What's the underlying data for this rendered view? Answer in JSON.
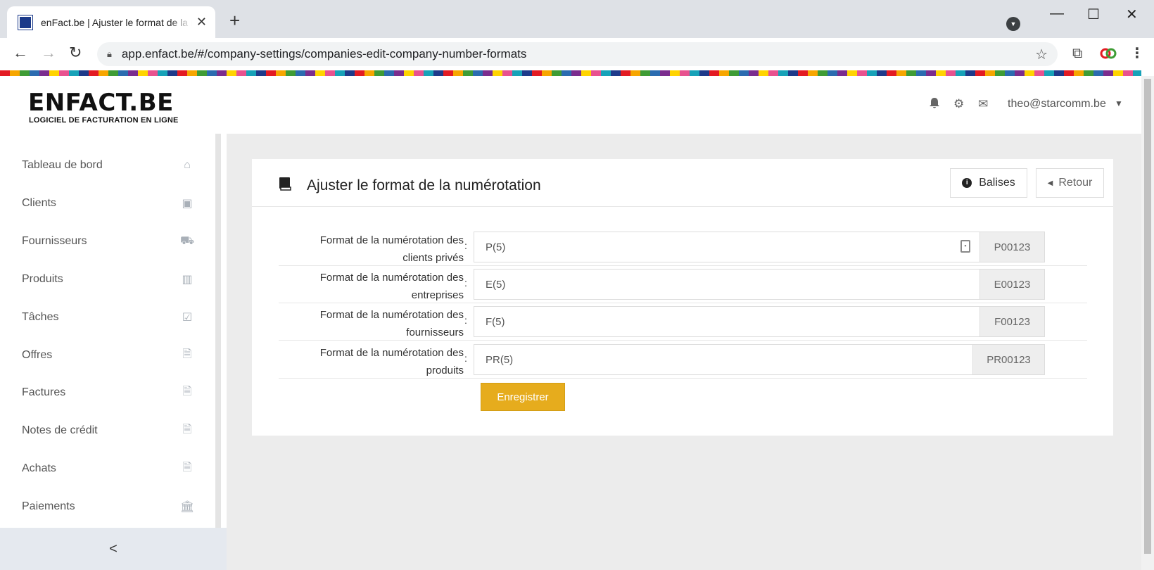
{
  "browser": {
    "tab_title": "enFact.be | Ajuster le format de la numérotation",
    "url": "app.enfact.be/#/company-settings/companies-edit-company-number-formats"
  },
  "header": {
    "logo_title": "ENFACT.BE",
    "logo_subtitle": "LOGICIEL DE FACTURATION EN LIGNE",
    "user_email": "theo@starcomm.be"
  },
  "sidebar": {
    "items": [
      {
        "label": "Tableau de bord",
        "icon": "home-icon"
      },
      {
        "label": "Clients",
        "icon": "contact-card-icon"
      },
      {
        "label": "Fournisseurs",
        "icon": "truck-icon"
      },
      {
        "label": "Produits",
        "icon": "barcode-icon"
      },
      {
        "label": "Tâches",
        "icon": "clipboard-check-icon"
      },
      {
        "label": "Offres",
        "icon": "pdf-file-icon"
      },
      {
        "label": "Factures",
        "icon": "pdf-file-icon"
      },
      {
        "label": "Notes de crédit",
        "icon": "pdf-file-icon"
      },
      {
        "label": "Achats",
        "icon": "pdf-file-icon"
      },
      {
        "label": "Paiements",
        "icon": "bank-icon"
      }
    ],
    "collapse_label": "<"
  },
  "card": {
    "title": "Ajuster le format de la numérotation",
    "tags_button": "Balises",
    "back_button": "Retour",
    "save_button": "Enregistrer"
  },
  "form": {
    "rows": [
      {
        "label_line1": "Format de la numérotation des",
        "label_line2": "clients privés",
        "value": "P(5)",
        "preview": "P00123"
      },
      {
        "label_line1": "Format de la numérotation des",
        "label_line2": "entreprises",
        "value": "E(5)",
        "preview": "E00123"
      },
      {
        "label_line1": "Format de la numérotation des",
        "label_line2": "fournisseurs",
        "value": "F(5)",
        "preview": "F00123"
      },
      {
        "label_line1": "Format de la numérotation des",
        "label_line2": "produits",
        "value": "PR(5)",
        "preview": "PR00123"
      }
    ]
  },
  "colors": {
    "accent": "#e6ac1d",
    "sidebar_icon": "#a9b0b8",
    "background": "#ececec"
  }
}
